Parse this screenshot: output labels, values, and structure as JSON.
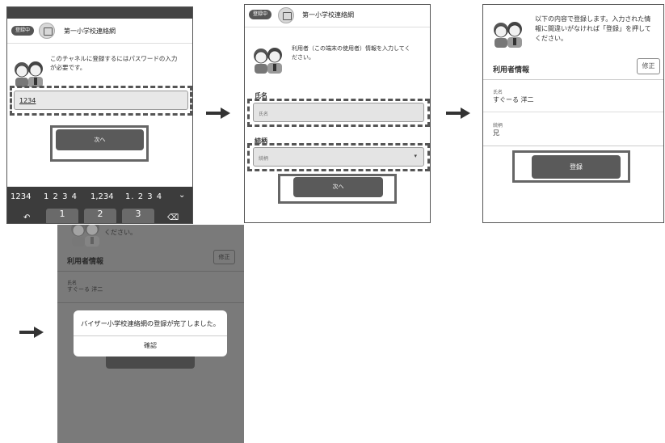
{
  "header": {
    "badge": "登録中",
    "title": "第一小学校連絡網"
  },
  "screen1": {
    "message_line1": "このチャネルに登録するにはパスワードの入力",
    "message_line2": "が必要です。",
    "password_value": "1234",
    "next_label": "次へ",
    "kb_suggestions": [
      "1234",
      "1 2 3 4",
      "1,234",
      "1. 2 3 4"
    ],
    "kb_keys": [
      "1",
      "2",
      "3"
    ]
  },
  "screen2": {
    "message_line1": "利用者（この端末の使用者）情報を入力してく",
    "message_line2": "ださい。",
    "name_label": "氏名",
    "name_placeholder": "氏名",
    "relation_label": "続柄",
    "relation_placeholder": "続柄",
    "next_label": "次へ"
  },
  "screen3": {
    "message_line1": "以下の内容で登録します。入力された情",
    "message_line2": "報に間違いがなければ「登録」を押して",
    "message_line3": "ください。",
    "section_title": "利用者情報",
    "edit_label": "修正",
    "name_label": "氏名",
    "name_value": "すぐーる 洋二",
    "relation_label": "続柄",
    "relation_value": "兄",
    "register_label": "登録"
  },
  "screen4": {
    "top_text": "ください。",
    "section_title": "利用者情報",
    "edit_label": "修正",
    "name_label": "氏名",
    "name_value": "すぐーる 洋二",
    "dialog_message": "バイザー小学校連絡網の登録が完了しました。",
    "dialog_confirm": "確認"
  },
  "colors": {
    "accent_dark": "#5a5a5a",
    "keyboard_bg": "#3a3a3a",
    "overlay": "#7a7a7a"
  }
}
